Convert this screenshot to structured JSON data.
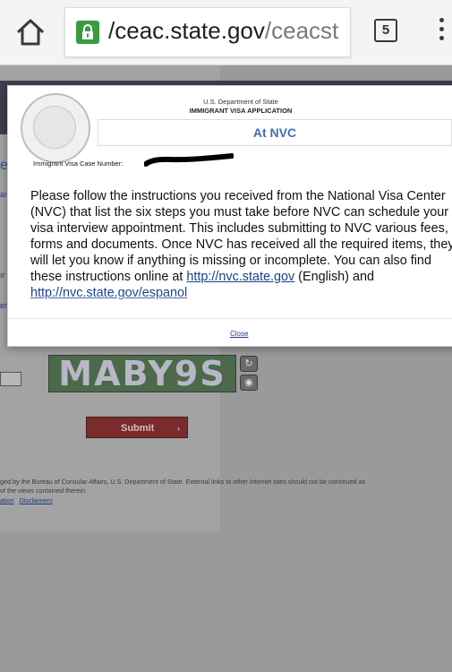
{
  "browser": {
    "url_host": "ceac.state.gov",
    "url_path": "/ceacst",
    "tab_count": "5",
    "icons": {
      "home": "home-icon",
      "lock": "lock-icon",
      "menu": "overflow-menu-icon"
    }
  },
  "page": {
    "left_fragments": [
      "e",
      "an",
      "ır",
      "er"
    ],
    "captcha_text": "MABY9S",
    "submit_label": "Submit",
    "submit_arrow": "›",
    "footer_line1": "ged by the Bureau of Consular Affairs, U.S. Department of State. External links to other Internet sites should not be construed as",
    "footer_line2": "of the views contained therein.",
    "footer_links": [
      "ation",
      "Disclaimers"
    ]
  },
  "modal": {
    "dept": "U.S. Department of State",
    "app_title": "IMMIGRANT VISA APPLICATION",
    "heading": "At NVC",
    "case_label": "Immigrant Visa Case Number:",
    "body_main": "Please follow the instructions you received from the National Visa Center (NVC) that list the six steps you must take before NVC can schedule your visa interview appointment. This includes submitting to NVC various fees, forms and documents. Once NVC has received all the required items, they will let you know if anything is missing or incomplete. You can also find these instructions online at",
    "link_en": "http://nvc.state.gov",
    "text_en": " (English) and ",
    "link_es": "http://nvc.state.gov/espanol",
    "close_label": "Close"
  },
  "colors": {
    "accent": "#3f6fb5",
    "lock_green": "#3c9a3f",
    "submit": "#7a2b2b"
  }
}
